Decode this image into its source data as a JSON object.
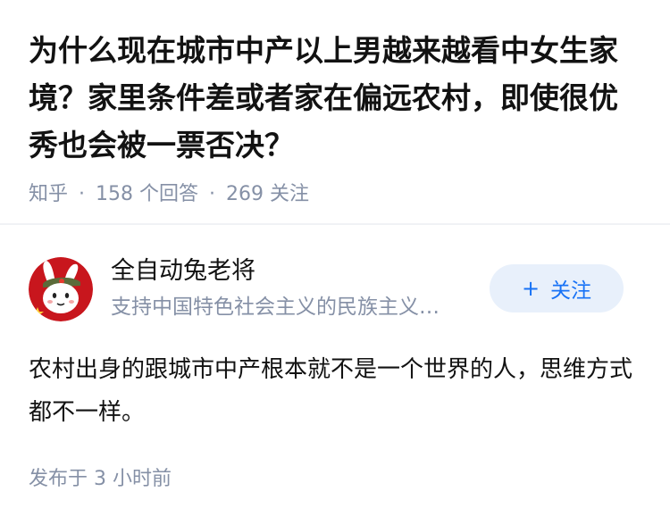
{
  "question": {
    "title": "为什么现在城市中产以上男越来越看中女生家境？家里条件差或者家在偏远农村，即使很优秀也会被一票否决？",
    "source": "知乎",
    "answers_count": "158",
    "answers_label": "个回答",
    "followers_count": "269",
    "followers_label": "关注",
    "separator": "·"
  },
  "answer": {
    "author": {
      "name": "全自动兔老将",
      "bio": "支持中国特色社会主义的民族主义…",
      "avatar_icon": "rabbit-soldier-avatar-icon"
    },
    "follow_button": {
      "icon": "plus-icon",
      "icon_glyph": "+",
      "label": "关注"
    },
    "content": "农村出身的跟城市中产根本就不是一个世界的人，思维方式都不一样。",
    "publish_label": "发布于",
    "publish_time": "3 小时前"
  },
  "colors": {
    "text_primary": "#121212",
    "text_secondary": "#8590a6",
    "accent": "#1772f6",
    "follow_bg": "#e8f0fb",
    "divider": "#f0f2f5",
    "avatar_red": "#c8161d"
  }
}
